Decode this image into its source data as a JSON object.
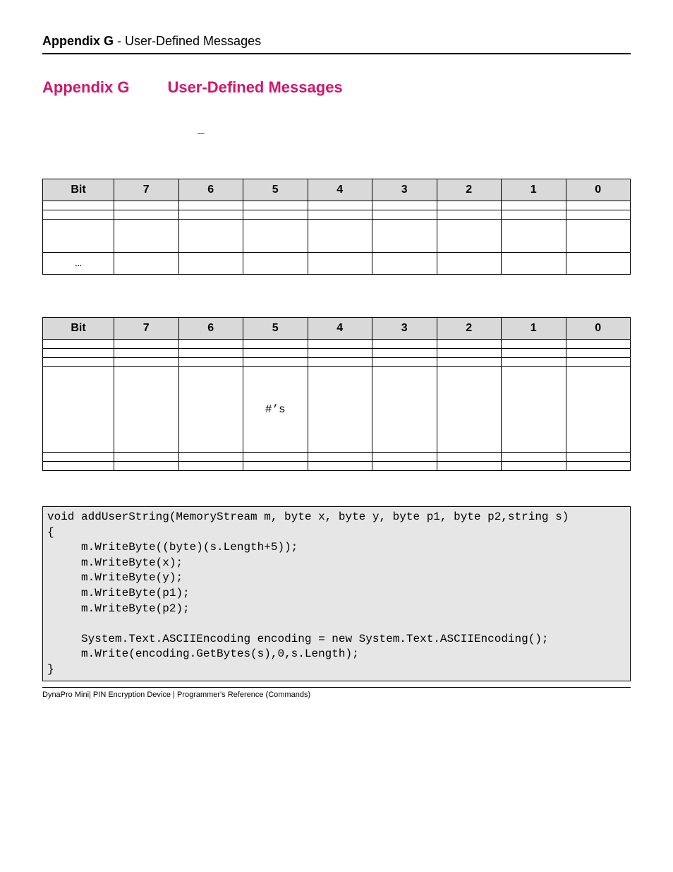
{
  "running_head": {
    "bold": "Appendix G",
    "rest": " - User-Defined Messages"
  },
  "title": {
    "label": "Appendix G",
    "name": "User-Defined Messages"
  },
  "underscore": "_",
  "table1": {
    "headers": [
      "Bit",
      "7",
      "6",
      "5",
      "4",
      "3",
      "2",
      "1",
      "0"
    ],
    "rows": [
      [
        "",
        "",
        "",
        "",
        "",
        "",
        "",
        "",
        ""
      ],
      [
        "",
        "",
        "",
        "",
        "",
        "",
        "",
        "",
        ""
      ],
      [
        "",
        "",
        "",
        "",
        "",
        "",
        "",
        "",
        ""
      ],
      [
        "…",
        "",
        "",
        "",
        "",
        "",
        "",
        "",
        ""
      ]
    ]
  },
  "table2": {
    "headers": [
      "Bit",
      "7",
      "6",
      "5",
      "4",
      "3",
      "2",
      "1",
      "0"
    ],
    "rows": [
      {
        "height": "normal",
        "cells": [
          "",
          "",
          "",
          "",
          "",
          "",
          "",
          "",
          ""
        ]
      },
      {
        "height": "normal",
        "cells": [
          "",
          "",
          "",
          "",
          "",
          "",
          "",
          "",
          ""
        ]
      },
      {
        "height": "normal",
        "cells": [
          "",
          "",
          "",
          "",
          "",
          "",
          "",
          "",
          ""
        ]
      },
      {
        "height": "tall",
        "cells": [
          "",
          "",
          "",
          "#’s",
          "",
          "",
          "",
          "",
          ""
        ]
      },
      {
        "height": "normal",
        "cells": [
          "",
          "",
          "",
          "",
          "",
          "",
          "",
          "",
          ""
        ]
      },
      {
        "height": "normal",
        "cells": [
          "",
          "",
          "",
          "",
          "",
          "",
          "",
          "",
          ""
        ]
      }
    ]
  },
  "code": "void addUserString(MemoryStream m, byte x, byte y, byte p1, byte p2,string s)\n{\n     m.WriteByte((byte)(s.Length+5));\n     m.WriteByte(x);\n     m.WriteByte(y);\n     m.WriteByte(p1);\n     m.WriteByte(p2);\n\n     System.Text.ASCIIEncoding encoding = new System.Text.ASCIIEncoding();\n     m.Write(encoding.GetBytes(s),0,s.Length);\n}",
  "footer": "DynaPro Mini| PIN Encryption Device | Programmer's Reference (Commands)"
}
